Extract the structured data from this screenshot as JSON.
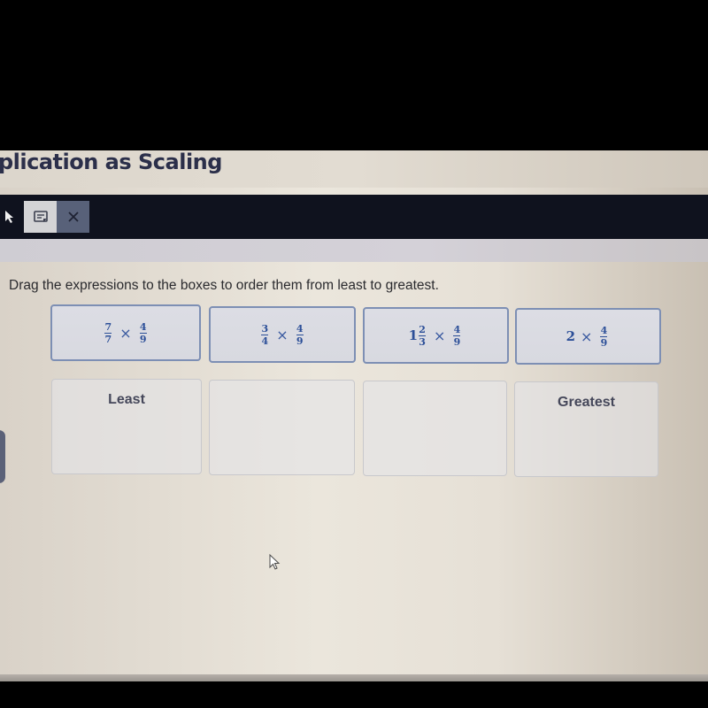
{
  "header": {
    "title": "plication as Scaling"
  },
  "toolbar": {
    "tools": [
      {
        "name": "pointer",
        "icon": "pointer-arrow-icon"
      },
      {
        "name": "notepad",
        "icon": "notepad-icon"
      },
      {
        "name": "close",
        "icon": "close-icon"
      }
    ]
  },
  "question": {
    "instruction": "Drag the expressions to the boxes to order them from least to greatest."
  },
  "expressions": [
    {
      "whole": "",
      "num": "7",
      "den": "7",
      "times": "×",
      "factor_num": "4",
      "factor_den": "9"
    },
    {
      "whole": "",
      "num": "3",
      "den": "4",
      "times": "×",
      "factor_num": "4",
      "factor_den": "9"
    },
    {
      "whole": "1",
      "num": "2",
      "den": "3",
      "times": "×",
      "factor_num": "4",
      "factor_den": "9"
    },
    {
      "whole": "2",
      "num": "",
      "den": "",
      "times": "×",
      "factor_num": "4",
      "factor_den": "9"
    }
  ],
  "drop_boxes": [
    {
      "label": "Least"
    },
    {
      "label": ""
    },
    {
      "label": ""
    },
    {
      "label": "Greatest"
    }
  ],
  "colors": {
    "expression_text": "#2c4f98",
    "card_border": "#7d8fb4",
    "toolbar_bg": "#0f121e",
    "title_text": "#2b2f4a"
  }
}
